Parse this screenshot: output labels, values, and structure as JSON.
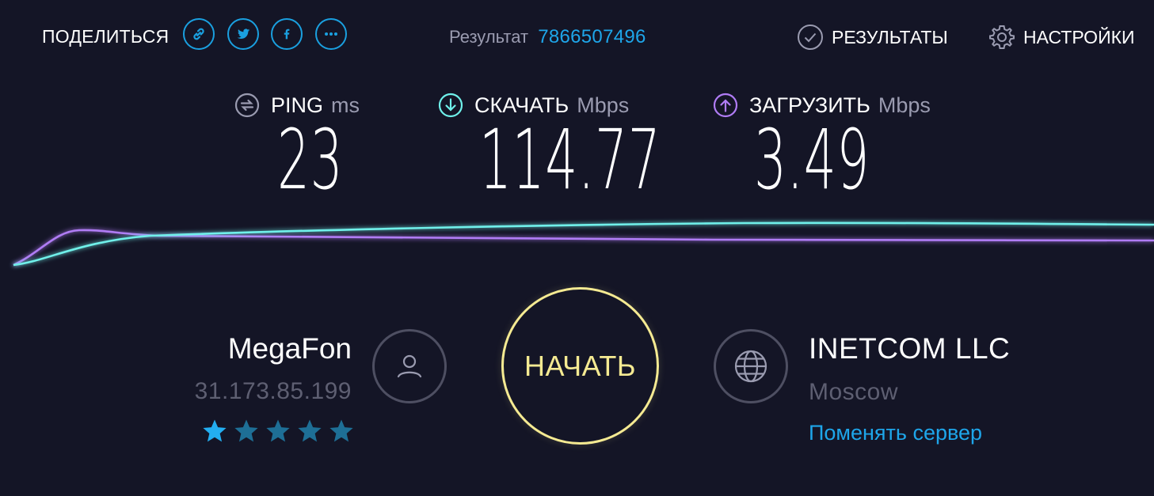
{
  "header": {
    "share_label": "ПОДЕЛИТЬСЯ",
    "share_buttons": [
      "link-icon",
      "twitter-icon",
      "facebook-icon",
      "more-icon"
    ],
    "result_label": "Результат",
    "result_id": "7866507496",
    "results_label": "РЕЗУЛЬТАТЫ",
    "settings_label": "НАСТРОЙКИ"
  },
  "metrics": {
    "ping": {
      "label": "PING",
      "unit": "ms",
      "value": "23",
      "icon": "ping-icon"
    },
    "download": {
      "label": "СКАЧАТЬ",
      "unit": "Mbps",
      "value": "114.77",
      "icon": "download-icon"
    },
    "upload": {
      "label": "ЗАГРУЗИТЬ",
      "unit": "Mbps",
      "value": "3.49",
      "icon": "upload-icon"
    }
  },
  "isp": {
    "name": "MegaFon",
    "ip": "31.173.85.199",
    "rating": 1,
    "rating_max": 5
  },
  "go_button": {
    "label": "НАЧАТЬ"
  },
  "server": {
    "name": "INETCOM LLC",
    "city": "Moscow",
    "change_label": "Поменять сервер"
  },
  "colors": {
    "background": "#141526",
    "accent_blue": "#1ea6ea",
    "download_cyan": "#6ff0ea",
    "upload_purple": "#b07cf5",
    "go_yellow": "#f5ea92"
  }
}
